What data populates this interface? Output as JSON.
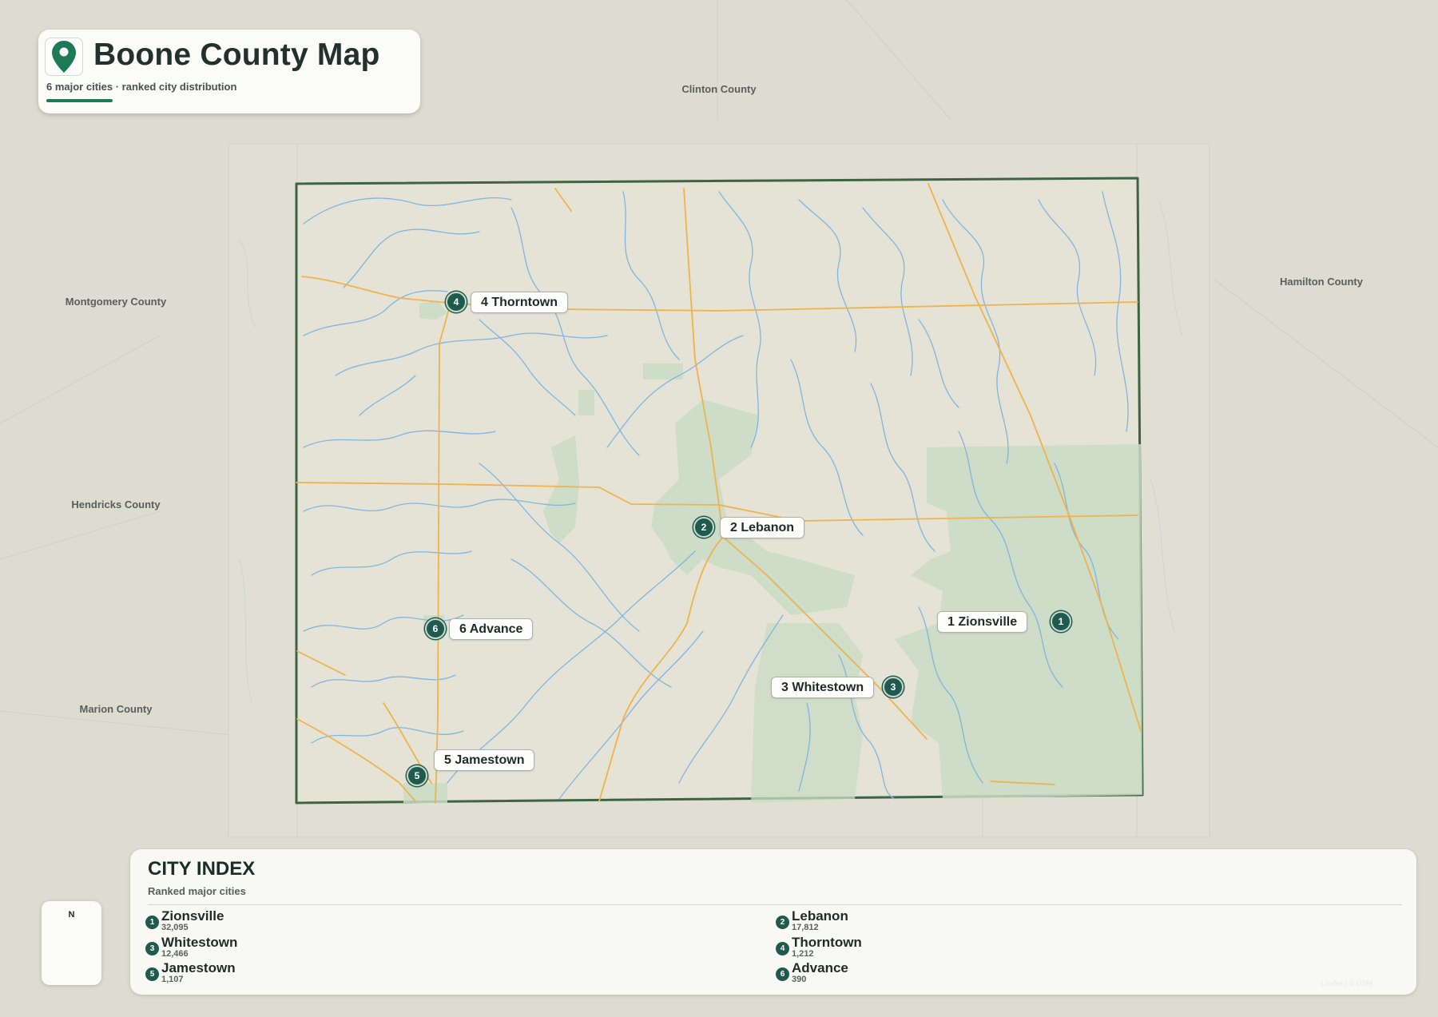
{
  "header": {
    "title": "Boone County Map",
    "subtitle": "6 major cities · ranked city distribution",
    "icon": "map-pin-icon"
  },
  "regions": [
    {
      "name": "Clinton County"
    },
    {
      "name": "Hamilton County"
    },
    {
      "name": "Montgomery County"
    },
    {
      "name": "Hendricks County"
    },
    {
      "name": "Marion County"
    }
  ],
  "cities": [
    {
      "rank": "1",
      "name": "Zionsville",
      "label": "1 Zionsville",
      "population": "32,095"
    },
    {
      "rank": "2",
      "name": "Lebanon",
      "label": "2 Lebanon",
      "population": "17,812"
    },
    {
      "rank": "3",
      "name": "Whitestown",
      "label": "3 Whitestown",
      "population": "12,466"
    },
    {
      "rank": "4",
      "name": "Thorntown",
      "label": "4 Thorntown",
      "population": "1,212"
    },
    {
      "rank": "5",
      "name": "Jamestown",
      "label": "5 Jamestown",
      "population": "1,107"
    },
    {
      "rank": "6",
      "name": "Advance",
      "label": "6 Advance",
      "population": "390"
    }
  ],
  "index": {
    "title": "CITY INDEX",
    "subtitle": "Ranked major cities"
  },
  "compass": {
    "north_label": "N"
  },
  "attribution": "Leaflet | © OSM",
  "colors": {
    "background": "#dedbd0",
    "county_fill": "#e4e3d6",
    "county_border": "#3d6440",
    "urban_fill": "#c9dcc4",
    "water": "#7fb6df",
    "roads": "#f0b24a",
    "marker": "#1f5b4c",
    "accent": "#1c7a55"
  }
}
